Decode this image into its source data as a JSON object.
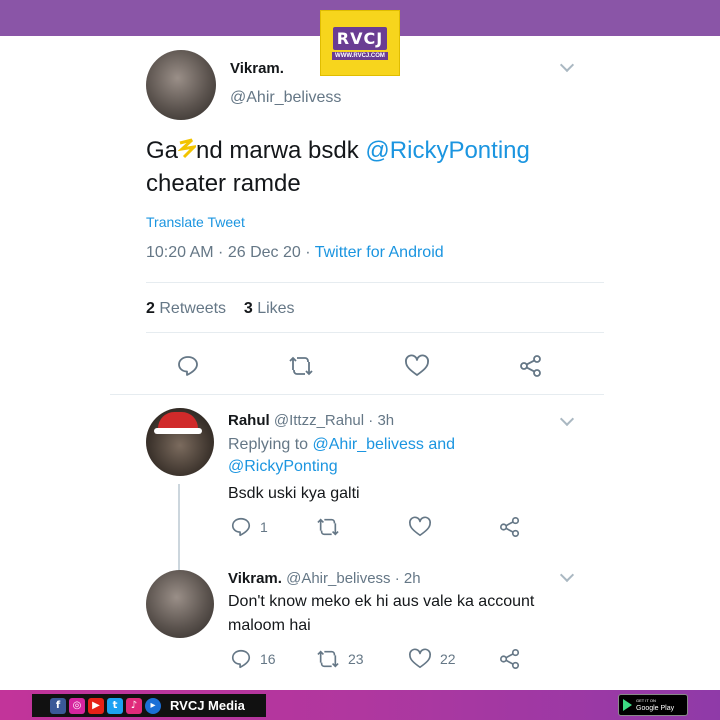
{
  "brand": {
    "logo_text": "RVCJ",
    "logo_url": "WWW.RVCJ.COM"
  },
  "main_tweet": {
    "name": "Vikram.",
    "handle": "@Ahir_belivess",
    "text_plain_1": "Ga",
    "text_plain_2": "nd marwa bsdk ",
    "text_mention": "@RickyPonting",
    "text_line2": "cheater ramde",
    "translate_label": "Translate Tweet",
    "time": "10:20 AM",
    "date": "26 Dec 20",
    "source": "Twitter for Android",
    "retweets_count": "2",
    "retweets_label": "Retweets",
    "likes_count": "3",
    "likes_label": "Likes"
  },
  "reply_1": {
    "name": "Rahul",
    "handle_time": "@Ittzz_Rahul · 3h",
    "replying_prefix": "Replying to ",
    "replying_to_1": "@Ahir_belivess",
    "replying_and": " and",
    "replying_to_2": "@RickyPonting",
    "text": "Bsdk uski kya galti",
    "reply_count": "1",
    "retweet_count": "",
    "like_count": ""
  },
  "reply_2": {
    "name": "Vikram.",
    "handle_time": "@Ahir_belivess · 2h",
    "text_line1": "Don't know meko ek hi aus vale ka account",
    "text_line2": "maloom hai",
    "reply_count": "16",
    "retweet_count": "23",
    "like_count": "22"
  },
  "footer": {
    "social_label": "RVCJ Media",
    "store_small": "GET IT ON",
    "store_label": "Google Play",
    "icons": [
      "facebook-icon",
      "instagram-icon",
      "youtube-icon",
      "twitter-icon",
      "music-icon",
      "play-icon"
    ]
  },
  "colors": {
    "accent": "#1b95e0",
    "brand_purple": "#8a55a7",
    "text_gray": "#657786"
  }
}
